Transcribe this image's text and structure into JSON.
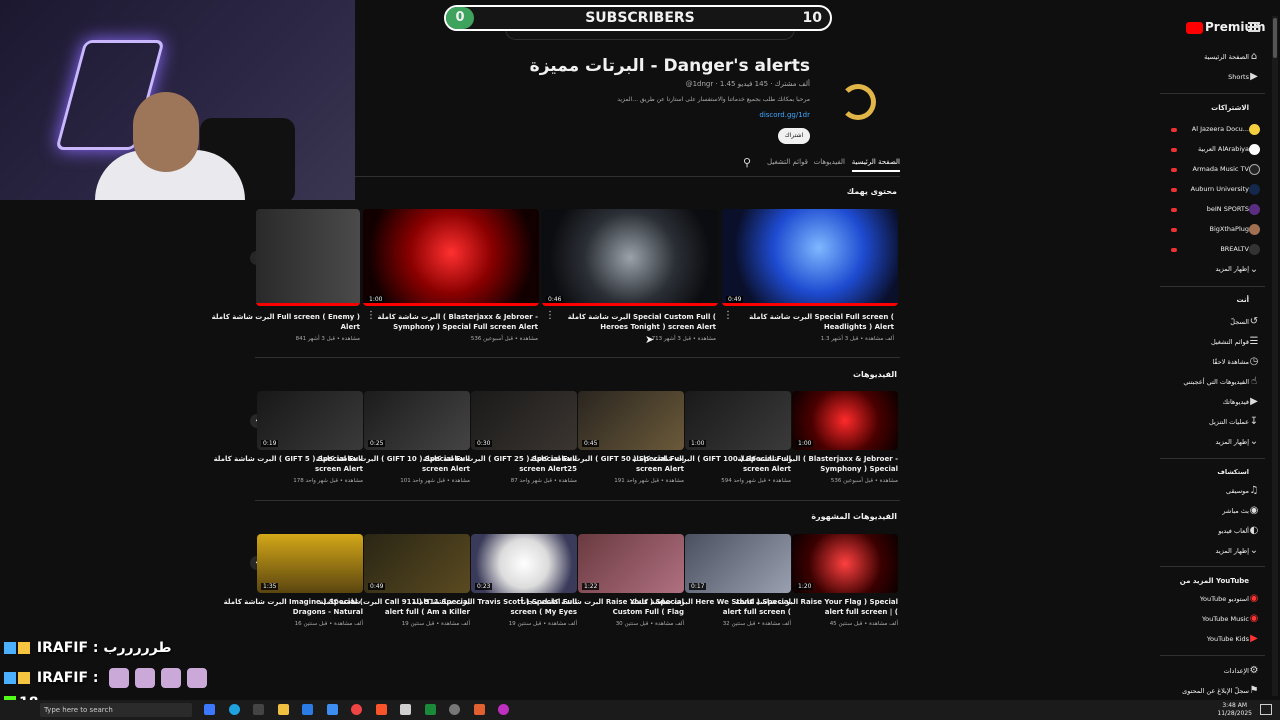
{
  "overlay": {
    "subs_current": "0",
    "subs_label": "SUBSCRIBERS",
    "subs_goal": "10",
    "chat": [
      {
        "user": "IRAFIF",
        "text": ": طرررررب"
      },
      {
        "user": "IRAFIF",
        "text": ":"
      }
    ],
    "viewer_count": "18"
  },
  "youtube": {
    "logo": "Premium",
    "search_placeholder": "بحث",
    "channel": {
      "title": "البرتات مميزة - Danger's alerts",
      "handle": "@1dngr",
      "stats": "@1dngr · 1.45 ألف مشترك · 145 فيديو",
      "description": "مرحبا بمكانك طلب بجميع خدماتنا والاستفسار على استارنا عن طريق ...المزيد",
      "link": "discord.gg/1dr",
      "subscribe_label": "اشتراك"
    },
    "tabs": [
      {
        "label": "الصفحة الرئيسية"
      },
      {
        "label": "الفيديوهات"
      },
      {
        "label": "قوائم التشغيل"
      }
    ],
    "sections": {
      "for_you": {
        "title": "محتوى يهمك",
        "items": [
          {
            "title": "البرت شاشة كاملة Special Full screen ( Headlights ) Alert",
            "meta": "1.3 ألف مشاهدة • قبل 3 أشهر",
            "duration": "0:49"
          },
          {
            "title": "البرت شاشة كاملة Special Custom Full ( Heroes Tonight ) screen Alert",
            "meta": "713 مشاهدة • قبل 3 أشهر",
            "duration": "0:46"
          },
          {
            "title": "البرت شاشة كاملة ( Blasterjaxx & Jebroer - Symphony ) Special Full screen Alert",
            "meta": "536 مشاهدة • قبل أسبوعين",
            "duration": "1:00"
          },
          {
            "title": "البرت شاشة كاملة Full screen ( Enemy ) Alert",
            "meta": "841 مشاهدة • قبل 3 أشهر",
            "duration": ""
          }
        ]
      },
      "videos": {
        "title": "الفيديوهات",
        "items": [
          {
            "title": "البرت شاشة كاملة ( Blasterjaxx & Jebroer - Symphony ) Special",
            "meta": "536 مشاهدة • قبل أسبوعين",
            "duration": "1:00"
          },
          {
            "title": "البرت شاشة كاملة ( GIFT 100 ) Special Full screen Alert",
            "meta": "594 مشاهدة • قبل شهر واحد",
            "duration": "1:00"
          },
          {
            "title": "البرت شاشة كاملة ( GIFT 50 ) Special Full screen Alert",
            "meta": "191 مشاهدة • قبل شهر واحد",
            "duration": "0:45"
          },
          {
            "title": "البرت شاشة كاملة ( GIFT 25 ) Special Full screen Alert25",
            "meta": "87 مشاهدة • قبل شهر واحد",
            "duration": "0:30"
          },
          {
            "title": "البرت شاشة كاملة ( GIFT 10 ) Special Full screen Alert",
            "meta": "101 مشاهدة • قبل شهر واحد",
            "duration": "0:25"
          },
          {
            "title": "البرت شاشة كاملة ( GIFT 5 ) Special Full screen Alert",
            "meta": "178 مشاهدة • قبل شهر واحد",
            "duration": "0:19"
          }
        ]
      },
      "popular": {
        "title": "الفيديوهات المشهورة",
        "items": [
          {
            "title": "البرت شاشة كاملة Raise Your Flag ) Special alert full screen | (",
            "meta": "45 ألف مشاهدة • قبل سنتين",
            "duration": "1:20"
          },
          {
            "title": "البرت شاشة كاملة Here We Stand ) Special alert full screen (",
            "meta": "32 ألف مشاهدة • قبل سنتين",
            "duration": "0:17"
          },
          {
            "title": "البرت شاشة كاملة مجاناً Raise Your ) Special Custom Full ( Flag",
            "meta": "30 ألف مشاهدة • قبل سنتين",
            "duration": "1:22"
          },
          {
            "title": "البرت شاشة كاملة Travis Scott ) Special Full screen ( My Eyes",
            "meta": "19 ألف مشاهدة • قبل سنتين",
            "duration": "0:23"
          },
          {
            "title": "البرت شاشة كاملة Call 911 ) 911 Special alert full ( Am a Killer",
            "meta": "19 ألف مشاهدة • قبل سنتين",
            "duration": "0:49"
          },
          {
            "title": "البرت شاشة كاملة Imagine ) Special ( Dragons - Natural",
            "meta": "16 ألف مشاهدة • قبل سنتين",
            "duration": "1:35"
          }
        ]
      }
    },
    "sidebar": {
      "home": "الصفحة الرئيسية",
      "shorts": "Shorts",
      "subs_heading": "الاشتراكات",
      "subscriptions": [
        "Al Jazeera Docu...",
        "العربية AlArabiya",
        "Armada Music TV",
        "Auburn University",
        "beIN SPORTS",
        "BigXthaPlug",
        "BREALTV"
      ],
      "show_more": "إظهار المزيد",
      "you_heading": "أنت",
      "you_items": [
        "السجلّ",
        "قوائم التشغيل",
        "مشاهدة لاحقًا",
        "الفيديوهات التي أعجبتني",
        "فيديوهاتك",
        "عمليات التنزيل"
      ],
      "explore_heading": "استكشاف",
      "explore_items": [
        "موسيقى",
        "بث مباشر",
        "ألعاب فيديو"
      ],
      "more_heading": "المزيد من YouTube",
      "more_items": [
        "YouTube استوديو",
        "YouTube Music",
        "YouTube Kids"
      ],
      "settings": "الإعدادات",
      "report": "سجلّ الإبلاغ عن المحتوى"
    }
  },
  "taskbar": {
    "search_placeholder": "Type here to search",
    "time": "3:48 AM",
    "date": "11/28/2025"
  }
}
